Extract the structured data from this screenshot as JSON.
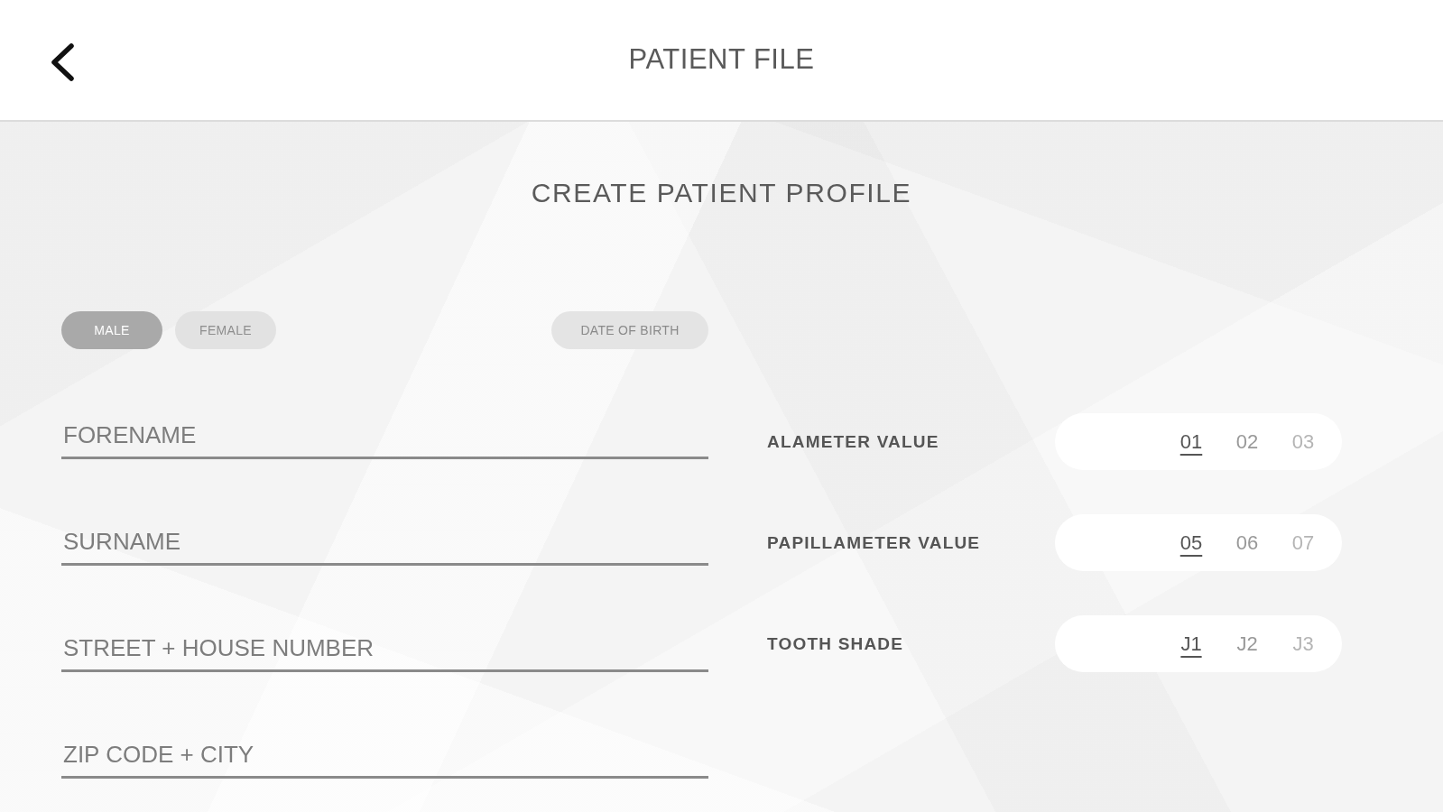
{
  "header": {
    "title": "PATIENT FILE"
  },
  "form": {
    "title": "CREATE PATIENT PROFILE",
    "gender": [
      {
        "label": "MALE",
        "selected": true
      },
      {
        "label": "FEMALE",
        "selected": false
      }
    ],
    "date_of_birth": {
      "label": "DATE OF BIRTH"
    },
    "fields": [
      {
        "placeholder": "FORENAME"
      },
      {
        "placeholder": "SURNAME"
      },
      {
        "placeholder": "STREET + HOUSE NUMBER"
      },
      {
        "placeholder": "ZIP CODE + CITY"
      }
    ],
    "selectors": [
      {
        "label": "ALAMETER VALUE",
        "options": [
          {
            "label": "01",
            "selected": true
          },
          {
            "label": "02",
            "selected": false
          },
          {
            "label": "03",
            "selected": false
          }
        ]
      },
      {
        "label": "PAPILLAMETER VALUE",
        "options": [
          {
            "label": "05",
            "selected": true
          },
          {
            "label": "06",
            "selected": false
          },
          {
            "label": "07",
            "selected": false
          }
        ]
      },
      {
        "label": "TOOTH SHADE",
        "options": [
          {
            "label": "J1",
            "selected": true
          },
          {
            "label": "J2",
            "selected": false
          },
          {
            "label": "J3",
            "selected": false
          }
        ]
      }
    ]
  }
}
